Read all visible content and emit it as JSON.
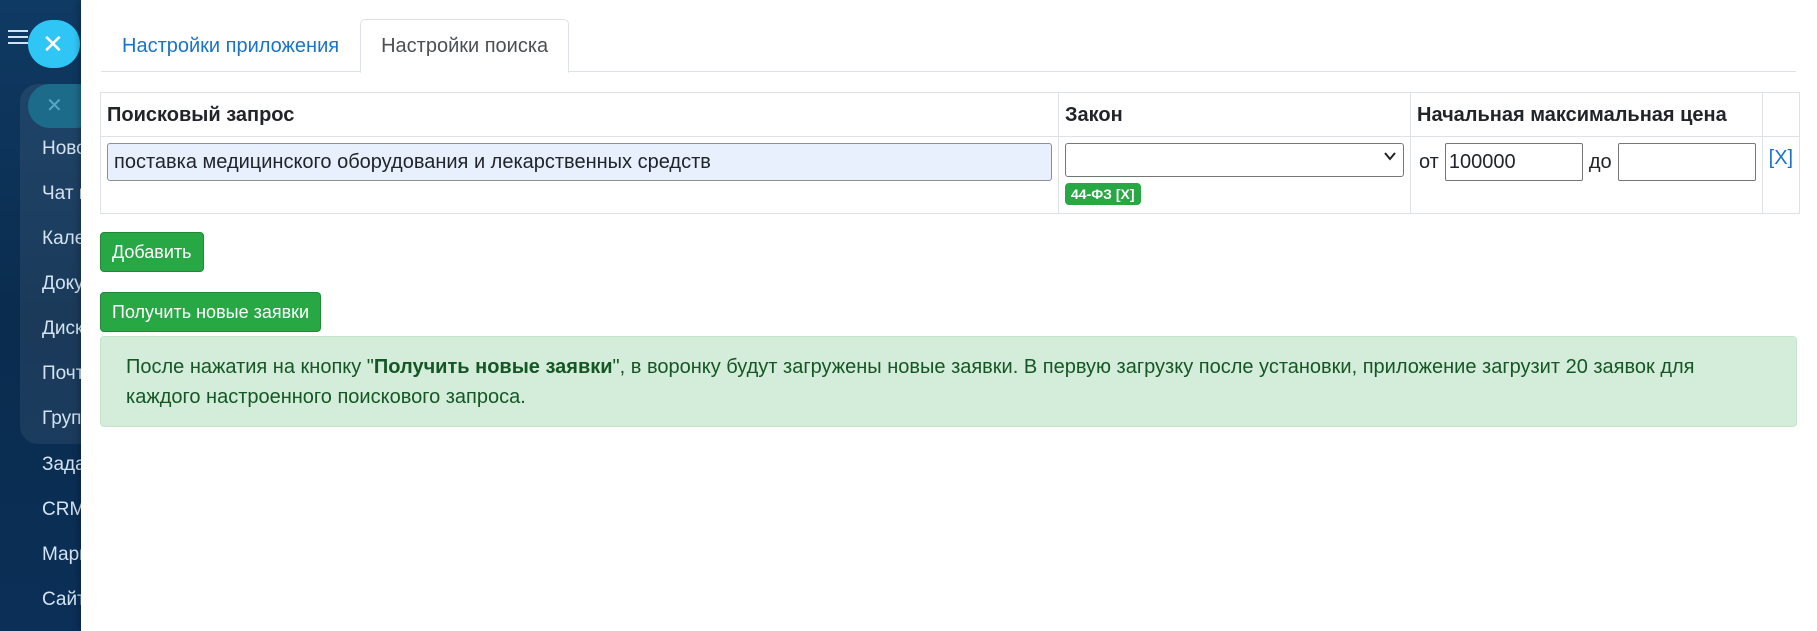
{
  "sidebar": {
    "items": [
      "Ново",
      "Чат и",
      "Кале",
      "Доку",
      "Диск",
      "Почт",
      "Груп",
      "Зада",
      "CRM",
      "Марк",
      "Сайт"
    ]
  },
  "tabs": [
    {
      "label": "Настройки приложения",
      "active": false
    },
    {
      "label": "Настройки поиска",
      "active": true
    }
  ],
  "table": {
    "headers": {
      "query": "Поисковый запрос",
      "law": "Закон",
      "price": "Начальная максимальная цена"
    },
    "row": {
      "query_value": "поставка медицинского оборудования и лекарственных средств",
      "law_selected": "",
      "law_badge": "44-ФЗ [X]",
      "price_from_label": "от",
      "price_from_value": "100000",
      "price_to_label": "до",
      "price_to_value": "",
      "delete_label": "[X]"
    }
  },
  "buttons": {
    "add": "Добавить",
    "fetch": "Получить новые заявки"
  },
  "alert": {
    "prefix": "После нажатия на кнопку \"",
    "bold": "Получить новые заявки",
    "suffix": "\", в воронку будут загружены новые заявки. В первую загрузку после установки, приложение загрузит 20 заявок для каждого настроенного поискового запроса."
  },
  "colors": {
    "accent_green": "#28a745",
    "link_blue": "#1a73c8",
    "alert_bg": "#d4edda",
    "sidebar_bg": "#0b2a4a"
  }
}
